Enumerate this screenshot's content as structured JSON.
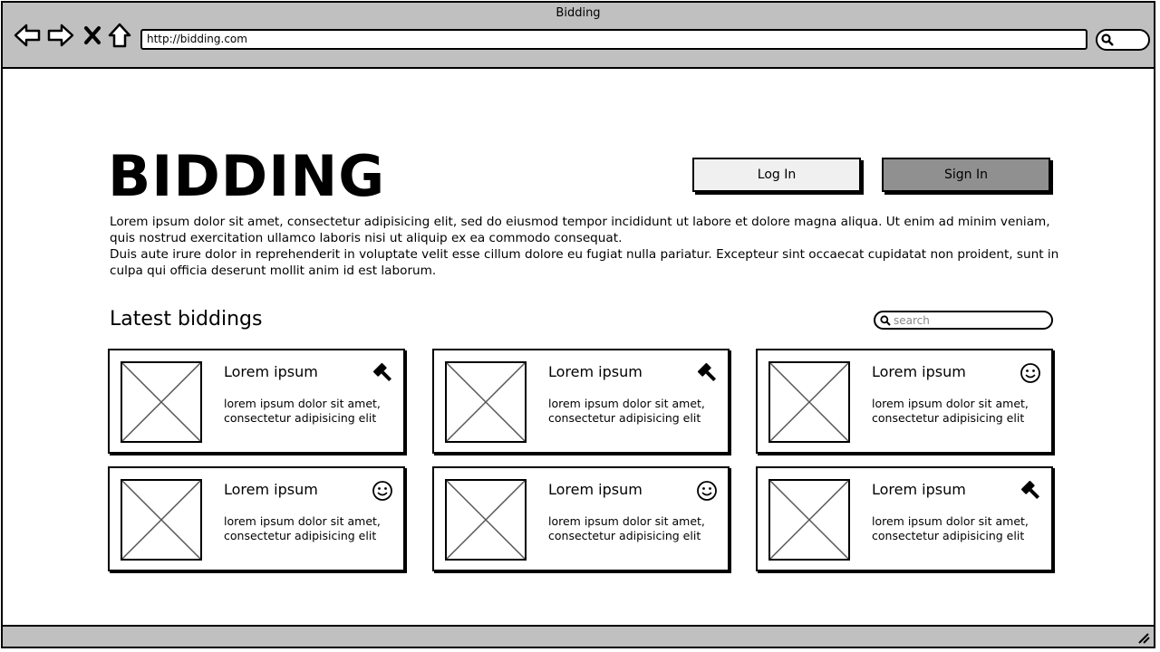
{
  "browser": {
    "window_title": "Bidding",
    "url": "http://bidding.com"
  },
  "header": {
    "logo": "BIDDING",
    "login_label": "Log In",
    "signin_label": "Sign In"
  },
  "intro": {
    "paragraph1": "Lorem ipsum dolor sit amet, consectetur adipisicing elit, sed do eiusmod tempor incididunt ut labore et dolore magna aliqua. Ut enim ad minim veniam, quis nostrud exercitation ullamco laboris nisi ut aliquip ex ea commodo consequat.",
    "paragraph2": "Duis aute irure dolor in reprehenderit in voluptate velit esse cillum dolore eu fugiat nulla pariatur. Excepteur sint occaecat cupidatat non proident, sunt in culpa qui officia deserunt mollit anim id est laborum."
  },
  "biddings": {
    "section_title": "Latest biddings",
    "search_placeholder": "search",
    "cards": [
      {
        "title": "Lorem ipsum",
        "description": "lorem ipsum dolor sit amet, consectetur adipisicing elit",
        "status_icon": "gavel-icon"
      },
      {
        "title": "Lorem ipsum",
        "description": "lorem ipsum dolor sit amet, consectetur adipisicing elit",
        "status_icon": "gavel-icon"
      },
      {
        "title": "Lorem ipsum",
        "description": "lorem ipsum dolor sit amet, consectetur adipisicing elit",
        "status_icon": "smiley-icon"
      },
      {
        "title": "Lorem ipsum",
        "description": "lorem ipsum dolor sit amet, consectetur adipisicing elit",
        "status_icon": "smiley-icon"
      },
      {
        "title": "Lorem ipsum",
        "description": "lorem ipsum dolor sit amet, consectetur adipisicing elit",
        "status_icon": "smiley-icon"
      },
      {
        "title": "Lorem ipsum",
        "description": "lorem ipsum dolor sit amet, consectetur adipisicing elit",
        "status_icon": "gavel-icon"
      }
    ]
  }
}
